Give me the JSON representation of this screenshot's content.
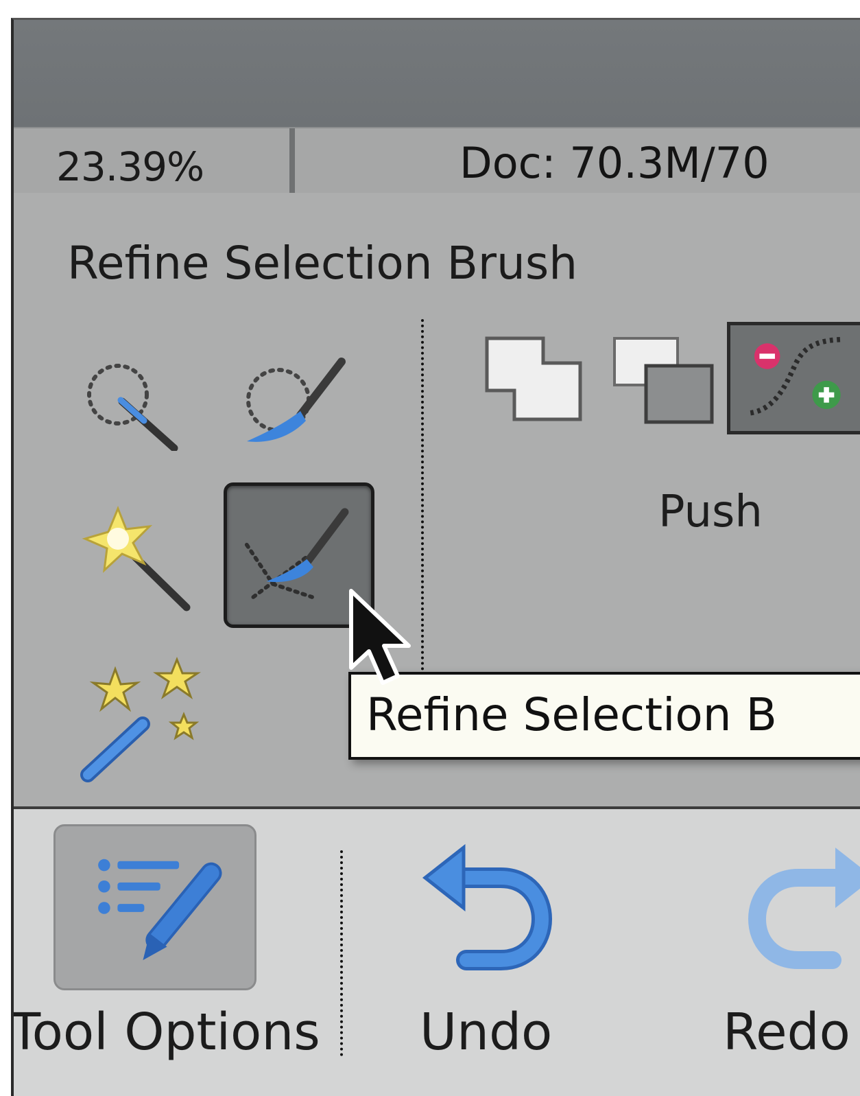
{
  "status_bar": {
    "zoom": "23.39%",
    "doc_size": "Doc: 70.3M/70"
  },
  "panel": {
    "title": "Refine Selection Brush",
    "tools": [
      {
        "icon": "quick-selection-icon"
      },
      {
        "icon": "selection-brush-icon"
      },
      {
        "icon": "magic-wand-icon"
      },
      {
        "icon": "refine-selection-brush-icon",
        "selected": true
      },
      {
        "icon": "auto-selection-icon"
      }
    ],
    "modes": [
      {
        "icon": "add-mode-icon"
      },
      {
        "icon": "subtract-mode-icon"
      },
      {
        "icon": "push-mode-icon",
        "selected": true
      }
    ],
    "mode_label": "Push"
  },
  "tooltip": {
    "text": "Refine Selection B"
  },
  "bottom_bar": {
    "tool_options": "Tool Options",
    "undo": "Undo",
    "redo": "Redo"
  },
  "colors": {
    "accent_blue": "#3d7fd6",
    "panel_gray": "#adaeae",
    "selected_gray": "#6d7071"
  }
}
